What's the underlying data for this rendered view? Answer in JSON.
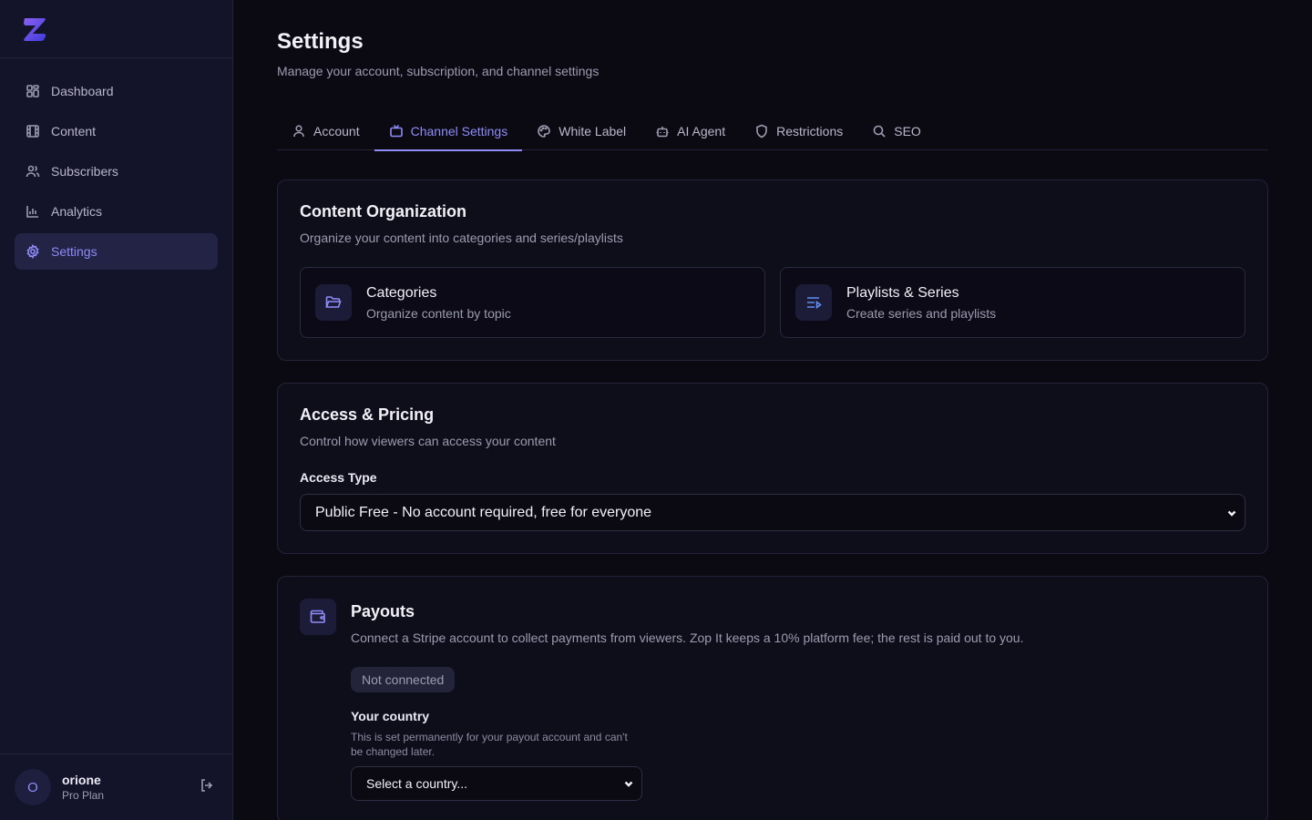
{
  "sidebar": {
    "logo": "zop-logo",
    "items": [
      {
        "label": "Dashboard",
        "icon": "dashboard-icon"
      },
      {
        "label": "Content",
        "icon": "film-icon"
      },
      {
        "label": "Subscribers",
        "icon": "users-icon"
      },
      {
        "label": "Analytics",
        "icon": "bar-chart-icon"
      },
      {
        "label": "Settings",
        "icon": "gear-icon",
        "active": true
      }
    ],
    "user": {
      "initial": "O",
      "name": "orione",
      "plan": "Pro Plan"
    }
  },
  "header": {
    "title": "Settings",
    "subtitle": "Manage your account, subscription, and channel settings"
  },
  "tabs": [
    {
      "label": "Account",
      "icon": "user-icon"
    },
    {
      "label": "Channel Settings",
      "icon": "tv-icon",
      "active": true
    },
    {
      "label": "White Label",
      "icon": "palette-icon"
    },
    {
      "label": "AI Agent",
      "icon": "bot-icon"
    },
    {
      "label": "Restrictions",
      "icon": "shield-icon"
    },
    {
      "label": "SEO",
      "icon": "search-icon"
    }
  ],
  "content_org": {
    "title": "Content Organization",
    "description": "Organize your content into categories and series/playlists",
    "items": [
      {
        "title": "Categories",
        "subtitle": "Organize content by topic",
        "icon": "folder-open-icon"
      },
      {
        "title": "Playlists & Series",
        "subtitle": "Create series and playlists",
        "icon": "playlist-icon"
      }
    ]
  },
  "access": {
    "title": "Access & Pricing",
    "description": "Control how viewers can access your content",
    "field_label": "Access Type",
    "selected": "Public Free - No account required, free for everyone"
  },
  "payouts": {
    "title": "Payouts",
    "description": "Connect a Stripe account to collect payments from viewers. Zop It keeps a 10% platform fee; the rest is paid out to you.",
    "status": "Not connected",
    "country_label": "Your country",
    "country_help": "This is set permanently for your payout account and can't be changed later.",
    "country_selected": "Select a country..."
  },
  "colors": {
    "accent": "#8f8cf8",
    "background": "#0b0a13",
    "sidebar": "#13132a"
  }
}
